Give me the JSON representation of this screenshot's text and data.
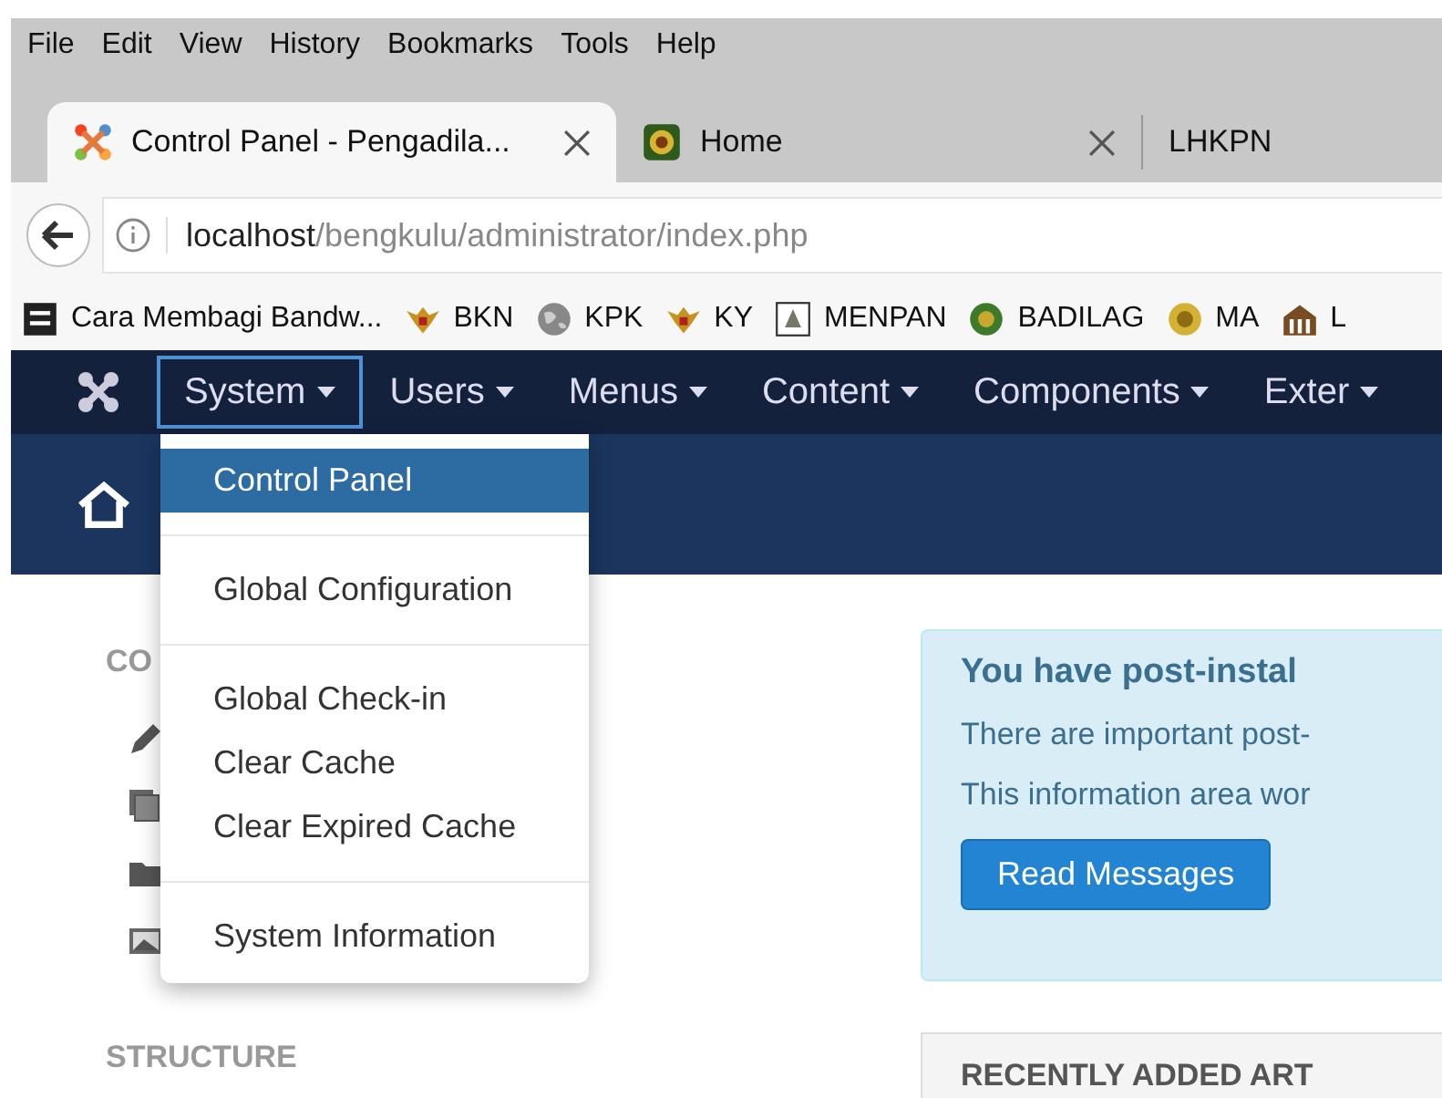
{
  "menu_bar": [
    "File",
    "Edit",
    "View",
    "History",
    "Bookmarks",
    "Tools",
    "Help"
  ],
  "tabs": [
    {
      "title": "Control Panel - Pengadila...",
      "selected": true,
      "kind": "joomla"
    },
    {
      "title": "Home",
      "selected": false,
      "kind": "seal"
    },
    {
      "title": "LHKPN",
      "selected": false,
      "kind": "plain"
    }
  ],
  "address": {
    "host": "localhost",
    "path": "/bengkulu/administrator/index.php"
  },
  "bookmarks": [
    {
      "label": "Cara Membagi Bandw...",
      "kind": "square"
    },
    {
      "label": "BKN",
      "kind": "bird"
    },
    {
      "label": "KPK",
      "kind": "globe"
    },
    {
      "label": "KY",
      "kind": "bird"
    },
    {
      "label": "MENPAN",
      "kind": "emblem"
    },
    {
      "label": "BADILAG",
      "kind": "seal"
    },
    {
      "label": "MA",
      "kind": "coin"
    },
    {
      "label": "L",
      "kind": "building"
    }
  ],
  "admin_nav": [
    {
      "label": "System",
      "selected": true
    },
    {
      "label": "Users",
      "selected": false
    },
    {
      "label": "Menus",
      "selected": false
    },
    {
      "label": "Content",
      "selected": false
    },
    {
      "label": "Components",
      "selected": false
    },
    {
      "label": "Exter",
      "selected": false
    }
  ],
  "dropdown": [
    [
      {
        "label": "Control Panel",
        "selected": true
      }
    ],
    [
      {
        "label": "Global Configuration",
        "selected": false
      }
    ],
    [
      {
        "label": "Global Check-in",
        "selected": false
      },
      {
        "label": "Clear Cache",
        "selected": false
      },
      {
        "label": "Clear Expired Cache",
        "selected": false
      }
    ],
    [
      {
        "label": "System Information",
        "selected": false
      }
    ]
  ],
  "sidebar": {
    "heading": "CO",
    "items": [
      {
        "kind": "pencil"
      },
      {
        "kind": "copies"
      },
      {
        "kind": "folder"
      },
      {
        "kind": "image"
      }
    ],
    "section": "STRUCTURE"
  },
  "message": {
    "title": "You have post-instal",
    "lines": [
      "There are important post-",
      "This information area wor"
    ],
    "button": "Read Messages"
  },
  "card": {
    "title": "RECENTLY ADDED ART"
  }
}
